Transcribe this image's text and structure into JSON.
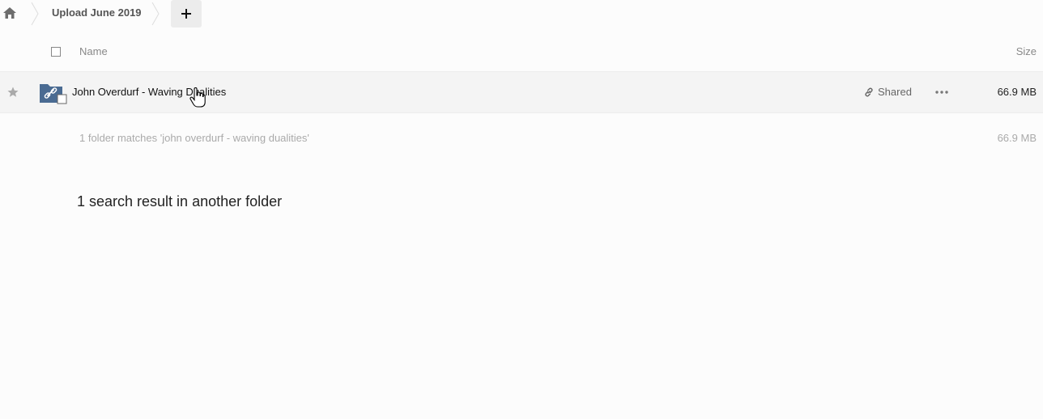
{
  "breadcrumb": {
    "home_icon": "home-icon",
    "current_folder": "Upload June 2019",
    "add_icon": "plus-icon"
  },
  "header": {
    "name_label": "Name",
    "size_label": "Size"
  },
  "files": [
    {
      "name": "John Overdurf - Waving Dualities",
      "type_icon": "shared-folder-icon",
      "shared_label": "Shared",
      "size": "66.9 MB",
      "favorite": false
    }
  ],
  "summary": {
    "text": "1 folder matches 'john overdurf - waving dualities'",
    "size": "66.9 MB"
  },
  "other_results": {
    "text": "1 search result in another folder"
  },
  "colors": {
    "folder": "#4a6b92",
    "background": "#fcfcfc",
    "row_hover": "#f4f4f4"
  }
}
